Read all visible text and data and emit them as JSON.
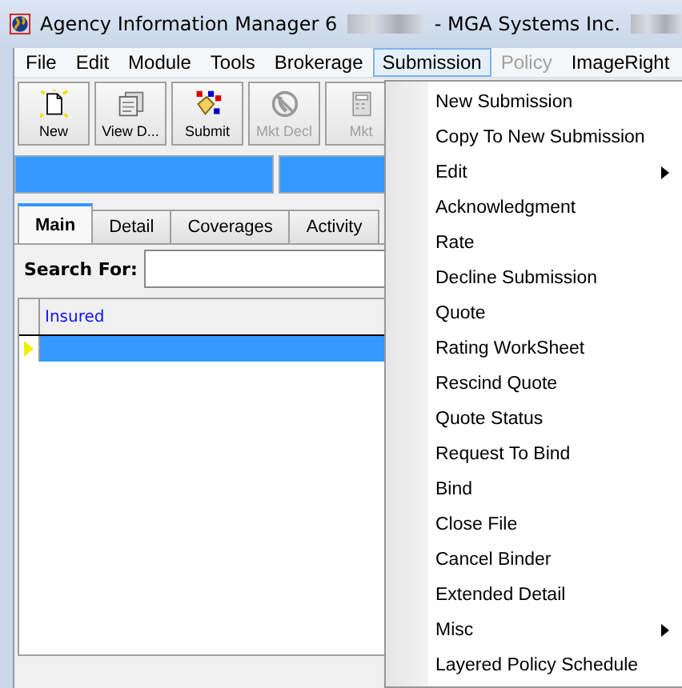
{
  "window": {
    "title": "Agency Information Manager 6",
    "subtitle": "- MGA Systems Inc."
  },
  "menu_bar": [
    {
      "label": "File",
      "selected": false,
      "disabled": false
    },
    {
      "label": "Edit",
      "selected": false,
      "disabled": false
    },
    {
      "label": "Module",
      "selected": false,
      "disabled": false
    },
    {
      "label": "Tools",
      "selected": false,
      "disabled": false
    },
    {
      "label": "Brokerage",
      "selected": false,
      "disabled": false
    },
    {
      "label": "Submission",
      "selected": true,
      "disabled": false
    },
    {
      "label": "Policy",
      "selected": false,
      "disabled": true
    },
    {
      "label": "ImageRight",
      "selected": false,
      "disabled": false
    }
  ],
  "toolbar": [
    {
      "label": "New",
      "kind": "new",
      "disabled": false
    },
    {
      "label": "View D...",
      "kind": "view",
      "disabled": false
    },
    {
      "label": "Submit",
      "kind": "submit",
      "disabled": false
    },
    {
      "label": "Mkt Decl",
      "kind": "decline",
      "disabled": true
    },
    {
      "label": "Mkt",
      "kind": "calc",
      "disabled": true
    }
  ],
  "tabs": [
    {
      "label": "Main",
      "selected": true
    },
    {
      "label": "Detail",
      "selected": false
    },
    {
      "label": "Coverages",
      "selected": false
    },
    {
      "label": "Activity",
      "selected": false
    }
  ],
  "search": {
    "label": "Search For:"
  },
  "grid": {
    "columns": [
      "Insured"
    ],
    "rows": [
      {
        "selected": true
      }
    ]
  },
  "dropdown_menu": [
    {
      "label": "New Submission",
      "submenu": false
    },
    {
      "label": "Copy To New Submission",
      "submenu": false
    },
    {
      "label": "Edit",
      "submenu": true
    },
    {
      "label": "Acknowledgment",
      "submenu": false
    },
    {
      "label": "Rate",
      "submenu": false
    },
    {
      "label": "Decline Submission",
      "submenu": false
    },
    {
      "label": "Quote",
      "submenu": false
    },
    {
      "label": "Rating WorkSheet",
      "submenu": false
    },
    {
      "label": "Rescind Quote",
      "submenu": false
    },
    {
      "label": "Quote Status",
      "submenu": false
    },
    {
      "label": "Request To Bind",
      "submenu": false
    },
    {
      "label": "Bind",
      "submenu": false
    },
    {
      "label": "Close File",
      "submenu": false
    },
    {
      "label": "Cancel Binder",
      "submenu": false
    },
    {
      "label": "Extended Detail",
      "submenu": false
    },
    {
      "label": "Misc",
      "submenu": true
    },
    {
      "label": "Layered Policy Schedule",
      "submenu": false
    }
  ]
}
